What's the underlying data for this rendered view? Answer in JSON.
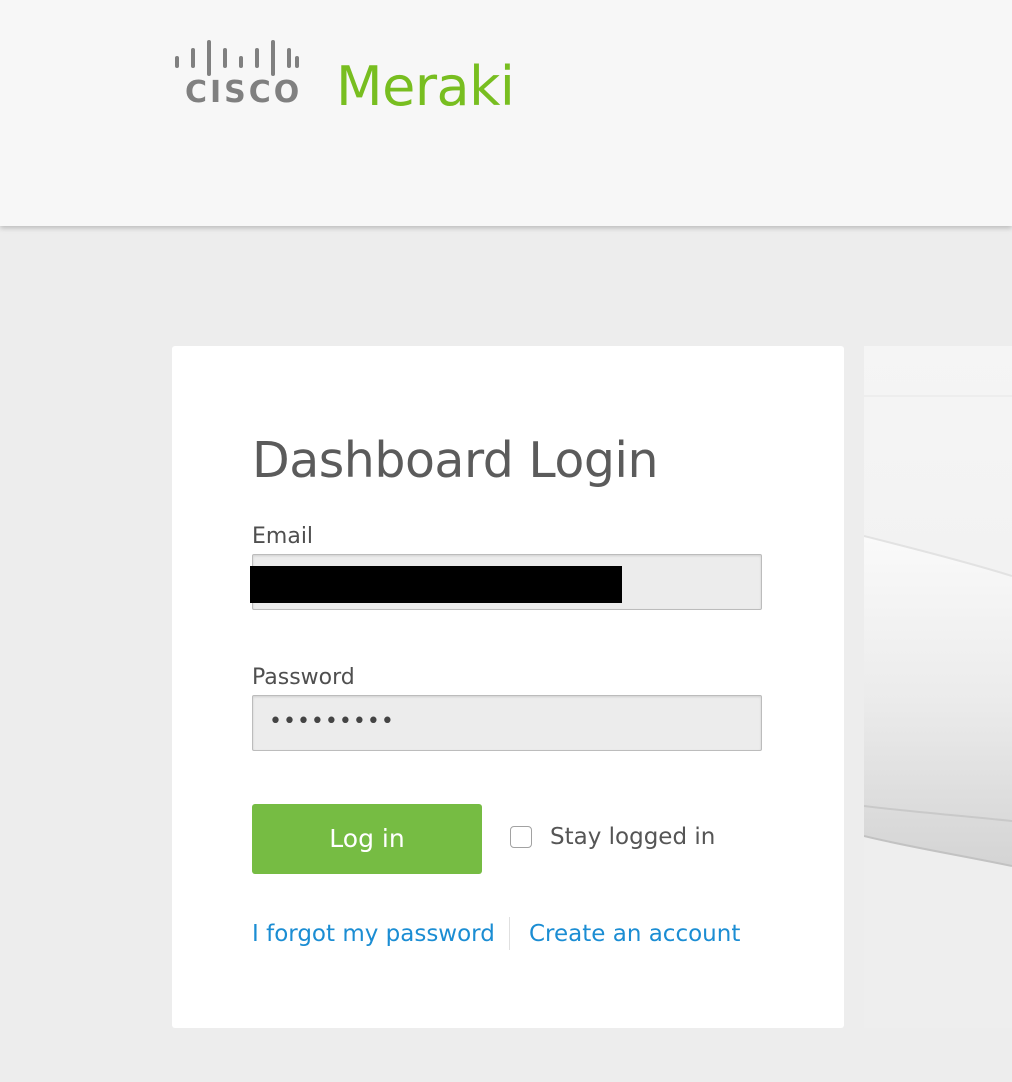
{
  "header": {
    "cisco_logo_text": "CISCO",
    "brand_name": "Meraki"
  },
  "login": {
    "title": "Dashboard Login",
    "email_label": "Email",
    "password_label": "Password",
    "password_value": "•••••••••",
    "login_button_label": "Log in",
    "stay_logged_in_label": "Stay logged in",
    "forgot_password_link": "I forgot my password",
    "create_account_link": "Create an account"
  },
  "colors": {
    "brand_green": "#78be20",
    "button_green": "#76bc43",
    "link_blue": "#1b8dd3",
    "header_bg": "#f7f7f7",
    "page_bg": "#ededed"
  },
  "icons": {
    "logo": "cisco-bars-logo",
    "checkbox": "checkbox-unchecked",
    "hero": "meraki-device-image"
  }
}
